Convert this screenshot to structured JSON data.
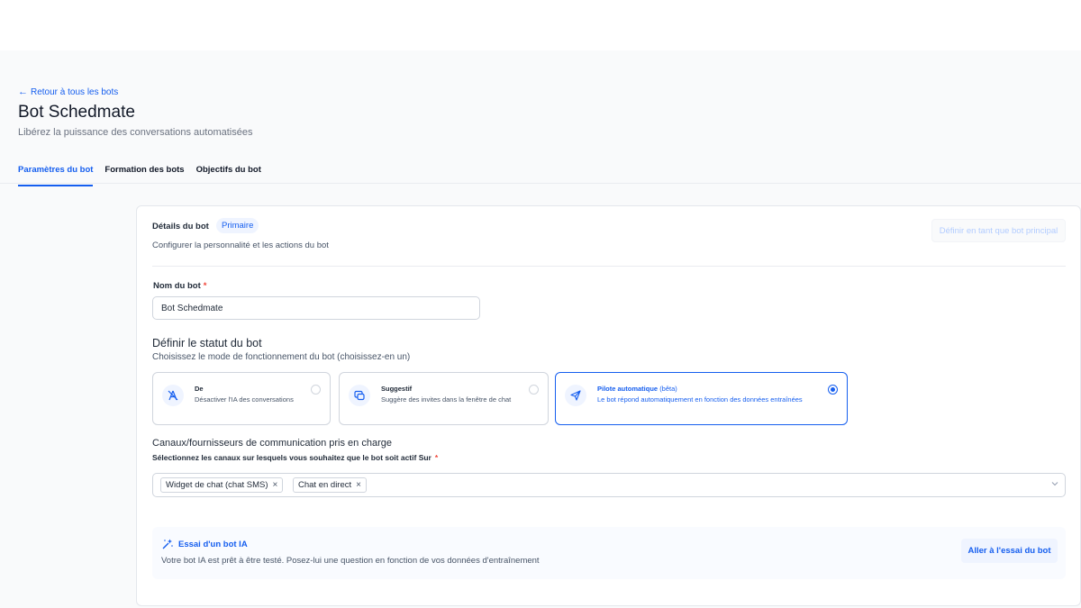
{
  "header": {
    "back_link": "Retour à tous les bots",
    "title": "Bot Schedmate",
    "subtitle": "Libérez la puissance des conversations automatisées"
  },
  "tabs": [
    {
      "label": "Paramètres du bot",
      "active": true
    },
    {
      "label": "Formation des bots",
      "active": false
    },
    {
      "label": "Objectifs du bot",
      "active": false
    }
  ],
  "bot_details": {
    "title": "Détails du bot",
    "badge": "Primaire",
    "description": "Configurer la personnalité et les actions du bot",
    "set_primary_label": "Définir en tant que bot principal"
  },
  "name_field": {
    "label": "Nom du bot",
    "required_mark": "*",
    "value": "Bot Schedmate"
  },
  "status": {
    "title": "Définir le statut du bot",
    "description": "Choisissez le mode de fonctionnement du bot (choisissez-en un)",
    "modes": [
      {
        "title": "De",
        "beta": "",
        "description": "Désactiver l'IA des conversations",
        "icon": "bot-off-icon",
        "selected": false
      },
      {
        "title": "Suggestif",
        "beta": "",
        "description": "Suggère des invites dans la fenêtre de chat",
        "icon": "chat-suggest-icon",
        "selected": false
      },
      {
        "title": "Pilote automatique",
        "beta": "(bêta)",
        "description": "Le bot répond automatiquement en fonction des données entraînées",
        "icon": "paper-plane-icon",
        "selected": true
      }
    ]
  },
  "channels": {
    "title": "Canaux/fournisseurs de communication pris en charge",
    "description": "Sélectionnez les canaux sur lesquels vous souhaitez que le bot soit actif Sur",
    "required_mark": "*",
    "selected": [
      "Widget de chat (chat SMS)",
      "Chat en direct"
    ],
    "remove_glyph": "×"
  },
  "trial": {
    "title": "Essai d'un bot IA",
    "description": "Votre bot IA est prêt à être testé. Posez-lui une question en fonction de vos données d'entraînement",
    "button_label": "Aller à l'essai du bot"
  },
  "colors": {
    "accent": "#155eef",
    "accent_light": "#eff4ff",
    "required": "#f04438"
  }
}
